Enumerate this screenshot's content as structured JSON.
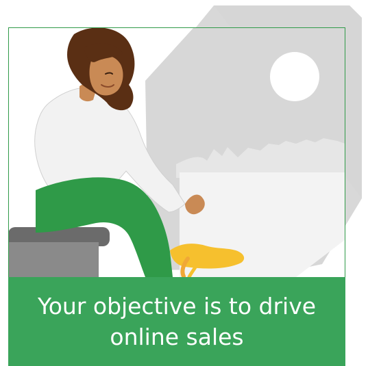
{
  "card": {
    "caption": "Your objective is to drive online sales"
  },
  "colors": {
    "accent_green": "#3aa45a",
    "card_border": "#2f9a48",
    "shoe_yellow": "#f6c02e",
    "pants_green": "#2f9a48",
    "background_gray": "#d5d5d5"
  },
  "icons": {
    "sun": "sun-icon"
  }
}
